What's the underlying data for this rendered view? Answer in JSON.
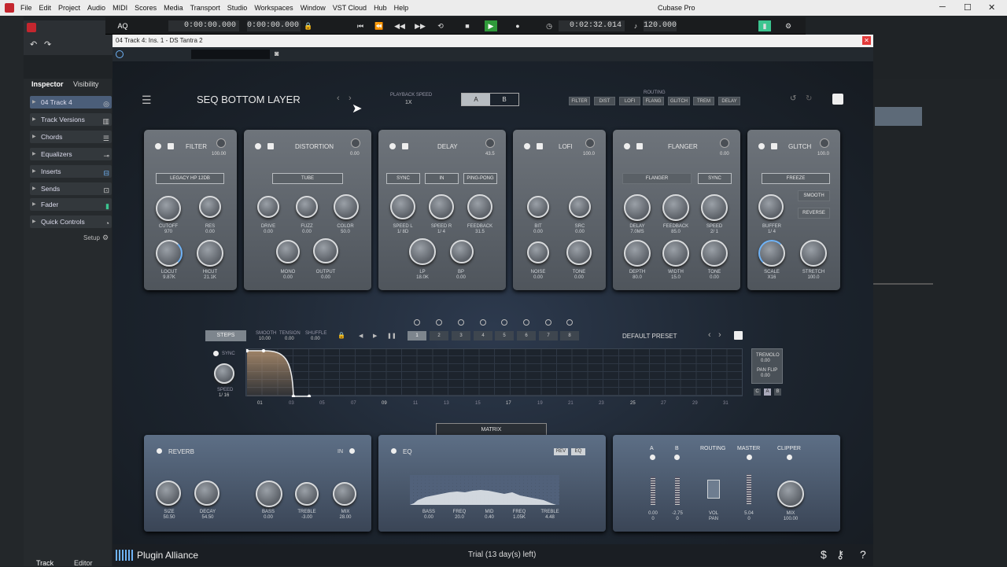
{
  "menubar": {
    "items": [
      "File",
      "Edit",
      "Project",
      "Audio",
      "MIDI",
      "Scores",
      "Media",
      "Transport",
      "Studio",
      "Workspaces",
      "Window",
      "VST Cloud",
      "Hub",
      "Help"
    ],
    "title": "Cubase Pro"
  },
  "transport": {
    "aq": "AQ",
    "pos1": "0:00:00.000",
    "pos2": "0:00:00.000",
    "time": "0:02:32.014",
    "tempo": "120.000"
  },
  "inspector": {
    "tabs": [
      "Inspector",
      "Visibility"
    ],
    "track_name": "04 Track 4",
    "items": [
      "Track Versions",
      "Chords",
      "Equalizers",
      "Inserts",
      "Sends",
      "Fader",
      "Quick Controls"
    ],
    "setup": "Setup"
  },
  "bottom_tabs": [
    "Track",
    "Editor"
  ],
  "plugin": {
    "window_title": "04 Track 4: Ins. 1 - DS Tantra 2",
    "preset_name": "SEQ BOTTOM LAYER",
    "playback_speed_label": "PLAYBACK SPEED",
    "playback_speed": "1X",
    "ab": [
      "A",
      "B"
    ],
    "routing_label": "ROUTING",
    "routing": [
      "FILTER",
      "DIST",
      "LOFI",
      "FLANG",
      "GLITCH",
      "TREM",
      "DELAY"
    ],
    "modules": {
      "filter": {
        "title": "FILTER",
        "value": "100.00",
        "select": "LEGACY HP 12DB",
        "knobs": [
          {
            "l": "CUTOFF",
            "v": "970"
          },
          {
            "l": "RES",
            "v": "0.00"
          },
          {
            "l": "LOCUT",
            "v": "9.87K"
          },
          {
            "l": "HICUT",
            "v": "21.1K"
          }
        ]
      },
      "distortion": {
        "title": "DISTORTION",
        "value": "0.00",
        "select": "TUBE",
        "knobs": [
          {
            "l": "DRIVE",
            "v": "0.00"
          },
          {
            "l": "FUZZ",
            "v": "0.00"
          },
          {
            "l": "COLOR",
            "v": "50.0"
          },
          {
            "l": "MONO",
            "v": "0.00"
          },
          {
            "l": "OUTPUT",
            "v": "0.00"
          }
        ]
      },
      "delay": {
        "title": "DELAY",
        "value": "43.5",
        "buttons": [
          "SYNC",
          "IN",
          "PING-PONG"
        ],
        "knobs": [
          {
            "l": "SPEED L",
            "v": "1/ 8D"
          },
          {
            "l": "SPEED R",
            "v": "1/ 4"
          },
          {
            "l": "FEEDBACK",
            "v": "31.5"
          },
          {
            "l": "LP",
            "v": "18.0K"
          },
          {
            "l": "BP",
            "v": "0.00"
          }
        ]
      },
      "lofi": {
        "title": "LOFI",
        "value": "100.0",
        "knobs": [
          {
            "l": "BIT",
            "v": "0.00"
          },
          {
            "l": "SRC",
            "v": "0.00"
          },
          {
            "l": "NOISE",
            "v": "0.00"
          },
          {
            "l": "TONE",
            "v": "0.00"
          }
        ]
      },
      "flanger": {
        "title": "FLANGER",
        "value": "0.00",
        "buttons": [
          "FLANGER",
          "SYNC"
        ],
        "knobs": [
          {
            "l": "DELAY",
            "v": "7.0MS"
          },
          {
            "l": "FEEDBACK",
            "v": "85.0"
          },
          {
            "l": "SPEED",
            "v": "2/ 1"
          },
          {
            "l": "DEPTH",
            "v": "80.0"
          },
          {
            "l": "WIDTH",
            "v": "15.0"
          },
          {
            "l": "TONE",
            "v": "0.00"
          }
        ]
      },
      "glitch": {
        "title": "GLITCH",
        "value": "100.0",
        "buttons": [
          "FREEZE",
          "SMOOTH",
          "REVERSE"
        ],
        "knobs": [
          {
            "l": "BUFFER",
            "v": "1/ 4"
          },
          {
            "l": "SCALE",
            "v": "X16"
          },
          {
            "l": "STRETCH",
            "v": "100.0"
          }
        ]
      }
    },
    "sequencer": {
      "steps_label": "STEPS",
      "params": [
        {
          "l": "SMOOTH",
          "v": "10.00"
        },
        {
          "l": "TENSION",
          "v": "0.00"
        },
        {
          "l": "SHUFFLE",
          "v": "0.00"
        }
      ],
      "step_numbers": [
        "1",
        "2",
        "3",
        "4",
        "5",
        "6",
        "7",
        "8"
      ],
      "preset": "DEFAULT PRESET",
      "sync": "SYNC",
      "speed_label": "SPEED",
      "speed": "1/ 16",
      "tremolo_label": "TREMOLO",
      "tremolo": "0.00",
      "panflip_label": "PAN FLIP",
      "panflip": "0.00",
      "abc": [
        "C",
        "A",
        "B"
      ],
      "ticks": [
        "01",
        "03",
        "05",
        "07",
        "09",
        "11",
        "13",
        "15",
        "17",
        "19",
        "21",
        "23",
        "25",
        "27",
        "29",
        "31"
      ]
    },
    "matrix": "MATRIX",
    "reverb": {
      "title": "REVERB",
      "in": "IN",
      "knobs": [
        {
          "l": "SIZE",
          "v": "50.50"
        },
        {
          "l": "DECAY",
          "v": "54.50"
        },
        {
          "l": "BASS",
          "v": "0.00"
        },
        {
          "l": "TREBLE",
          "v": "-3.00"
        },
        {
          "l": "MIX",
          "v": "28.00"
        }
      ]
    },
    "eq": {
      "title": "EQ",
      "tags": [
        "REV",
        "EQ"
      ],
      "knobs": [
        {
          "l": "BASS",
          "v": "0.00"
        },
        {
          "l": "FREQ",
          "v": "20.0"
        },
        {
          "l": "MID",
          "v": "0.40"
        },
        {
          "l": "FREQ",
          "v": "1.05K"
        },
        {
          "l": "TREBLE",
          "v": "4.48"
        }
      ]
    },
    "master": {
      "labels": [
        "A",
        "B",
        "ROUTING",
        "MASTER",
        "CLIPPER"
      ],
      "values": [
        {
          "l": "",
          "v": "0.00"
        },
        {
          "l": "",
          "v": "-2.75"
        },
        {
          "l": "VOL",
          "v": ""
        },
        {
          "l": "",
          "v": "5.04"
        },
        {
          "l": "MIX",
          "v": "100.00"
        }
      ],
      "sub": [
        "0",
        "0",
        "PAN",
        "0",
        "100.00"
      ]
    },
    "footer": {
      "brand": "Plugin Alliance",
      "trial": "Trial (13 day(s) left)"
    }
  }
}
